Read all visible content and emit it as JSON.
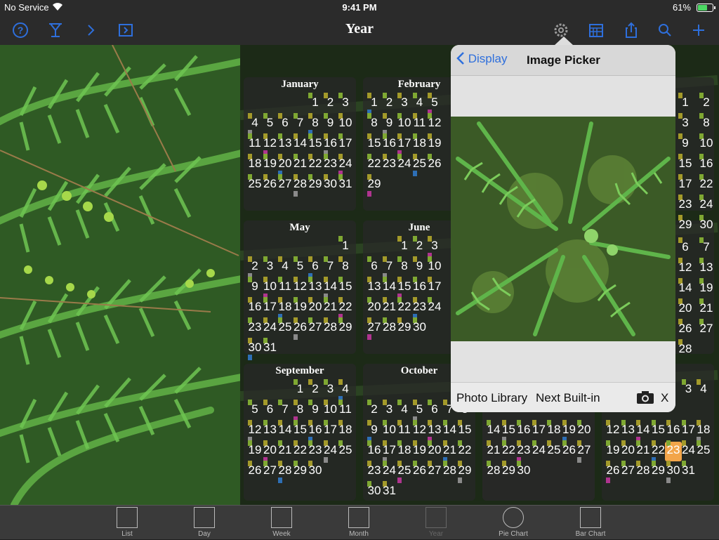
{
  "status": {
    "carrier": "No Service",
    "time": "9:41 PM",
    "battery": "61%"
  },
  "navbar": {
    "title": "Year"
  },
  "popover": {
    "back_label": "Display",
    "title": "Image Picker",
    "photo_library": "Photo Library",
    "next_builtin": "Next Built-in",
    "close": "X"
  },
  "months": [
    {
      "name": "January",
      "rows": [
        [
          "",
          "",
          "",
          "",
          "1",
          "2",
          "3"
        ],
        [
          "4",
          "5",
          "6",
          "7",
          "8",
          "9",
          "10"
        ],
        [
          "11",
          "12",
          "13",
          "14",
          "15",
          "16",
          "17"
        ],
        [
          "18",
          "19",
          "20",
          "21",
          "22",
          "23",
          "24"
        ],
        [
          "25",
          "26",
          "27",
          "28",
          "29",
          "30",
          "31"
        ]
      ]
    },
    {
      "name": "February",
      "rows": [
        [
          "1",
          "2",
          "3",
          "4",
          "5",
          "",
          ""
        ],
        [
          "8",
          "9",
          "10",
          "11",
          "12",
          "",
          ""
        ],
        [
          "15",
          "16",
          "17",
          "18",
          "19",
          "",
          ""
        ],
        [
          "22",
          "23",
          "24",
          "25",
          "26",
          "",
          ""
        ],
        [
          "29",
          "",
          "",
          "",
          "",
          "",
          ""
        ]
      ]
    },
    {
      "name": "May",
      "rows": [
        [
          "",
          "",
          "",
          "",
          "",
          "",
          "1"
        ],
        [
          "2",
          "3",
          "4",
          "5",
          "6",
          "7",
          "8"
        ],
        [
          "9",
          "10",
          "11",
          "12",
          "13",
          "14",
          "15"
        ],
        [
          "16",
          "17",
          "18",
          "19",
          "20",
          "21",
          "22"
        ],
        [
          "23",
          "24",
          "25",
          "26",
          "27",
          "28",
          "29"
        ],
        [
          "30",
          "31",
          "",
          "",
          "",
          "",
          ""
        ]
      ]
    },
    {
      "name": "June",
      "rows": [
        [
          "",
          "",
          "1",
          "2",
          "3",
          "",
          ""
        ],
        [
          "6",
          "7",
          "8",
          "9",
          "10",
          "",
          ""
        ],
        [
          "13",
          "14",
          "15",
          "16",
          "17",
          "",
          ""
        ],
        [
          "20",
          "21",
          "22",
          "23",
          "24",
          "",
          ""
        ],
        [
          "27",
          "28",
          "29",
          "30",
          "",
          "",
          ""
        ]
      ]
    },
    {
      "name": "September",
      "rows": [
        [
          "",
          "",
          "",
          "1",
          "2",
          "3",
          "4"
        ],
        [
          "5",
          "6",
          "7",
          "8",
          "9",
          "10",
          "11"
        ],
        [
          "12",
          "13",
          "14",
          "15",
          "16",
          "17",
          "18"
        ],
        [
          "19",
          "20",
          "21",
          "22",
          "23",
          "24",
          "25"
        ],
        [
          "26",
          "27",
          "28",
          "29",
          "30",
          "",
          ""
        ]
      ]
    },
    {
      "name": "October",
      "rows": [
        [
          "",
          "",
          "",
          "",
          "",
          "",
          ""
        ],
        [
          "2",
          "3",
          "4",
          "5",
          "6",
          "7",
          "8"
        ],
        [
          "9",
          "10",
          "11",
          "12",
          "13",
          "14",
          "15"
        ],
        [
          "16",
          "17",
          "18",
          "19",
          "20",
          "21",
          "22"
        ],
        [
          "23",
          "24",
          "25",
          "26",
          "27",
          "28",
          "29"
        ],
        [
          "30",
          "31",
          "",
          "",
          "",
          "",
          ""
        ]
      ]
    },
    {
      "name": "",
      "rows": [
        [
          "",
          "",
          "",
          "",
          "",
          "",
          ""
        ],
        [
          "",
          "",
          "",
          "",
          "",
          "",
          ""
        ],
        [
          "",
          "",
          "",
          "",
          "",
          "",
          ""
        ],
        [
          "",
          "",
          "",
          "",
          "",
          "",
          ""
        ],
        [
          "",
          "",
          "",
          "",
          "",
          "",
          ""
        ]
      ]
    },
    {
      "name": "",
      "rows": [
        [
          "",
          "",
          "",
          "",
          "",
          "",
          ""
        ],
        [
          "",
          "",
          "",
          "",
          "",
          "",
          ""
        ],
        [
          "14",
          "15",
          "16",
          "17",
          "18",
          "19",
          "20"
        ],
        [
          "21",
          "22",
          "23",
          "24",
          "25",
          "26",
          "27"
        ],
        [
          "28",
          "29",
          "30",
          "",
          "",
          "",
          ""
        ]
      ]
    },
    {
      "name": "",
      "rows": [
        [
          "",
          "",
          "",
          "",
          "",
          "",
          ""
        ],
        [
          "",
          "",
          "",
          "",
          "",
          "",
          ""
        ],
        [
          "",
          "",
          "",
          "",
          "",
          "",
          ""
        ],
        [
          "",
          "",
          "",
          "",
          "",
          "",
          ""
        ],
        [
          "",
          "",
          "",
          "",
          "",
          "",
          ""
        ]
      ]
    },
    {
      "name": "",
      "rows": [
        [
          "",
          "",
          "",
          "",
          "",
          "",
          ""
        ],
        [
          "",
          "",
          "",
          "",
          "",
          "",
          ""
        ],
        [
          "",
          "",
          "",
          "",
          "",
          "",
          ""
        ],
        [
          "",
          "",
          "",
          "",
          "",
          "",
          ""
        ],
        [
          "",
          "",
          "",
          "",
          "",
          "",
          ""
        ]
      ]
    },
    {
      "name": "er",
      "rows": [
        [
          "",
          "",
          "",
          "",
          "",
          "3",
          "4"
        ],
        [
          "",
          "",
          "",
          "",
          "",
          "",
          ""
        ],
        [
          "12",
          "13",
          "14",
          "15",
          "16",
          "17",
          "18"
        ],
        [
          "19",
          "20",
          "21",
          "22",
          "23",
          "24",
          "25"
        ],
        [
          "26",
          "27",
          "28",
          "29",
          "30",
          "31",
          ""
        ]
      ]
    }
  ],
  "right_col": {
    "row1": [
      "1",
      "2",
      "3",
      "8",
      "9",
      "10",
      "15",
      "16",
      "17",
      "22",
      "23",
      "24",
      "29",
      "30"
    ],
    "row2": [
      "6",
      "7",
      "12",
      "13",
      "14",
      "19",
      "20",
      "21",
      "26",
      "27",
      "28"
    ]
  },
  "tabs": [
    {
      "label": "List",
      "icon": "list-icon"
    },
    {
      "label": "Day",
      "icon": "day-icon"
    },
    {
      "label": "Week",
      "icon": "week-icon"
    },
    {
      "label": "Month",
      "icon": "month-icon"
    },
    {
      "label": "Year",
      "icon": "year-icon"
    },
    {
      "label": "Pie Chart",
      "icon": "pie-chart-icon"
    },
    {
      "label": "Bar Chart",
      "icon": "bar-chart-icon"
    }
  ],
  "colors": {
    "accent": "#2e6fdc",
    "olive": "#a39a2a",
    "green": "#7fa832",
    "magenta": "#b0348f",
    "gray": "#8a8a8a",
    "blue": "#2e6fb5",
    "orange": "#f2a54a"
  }
}
